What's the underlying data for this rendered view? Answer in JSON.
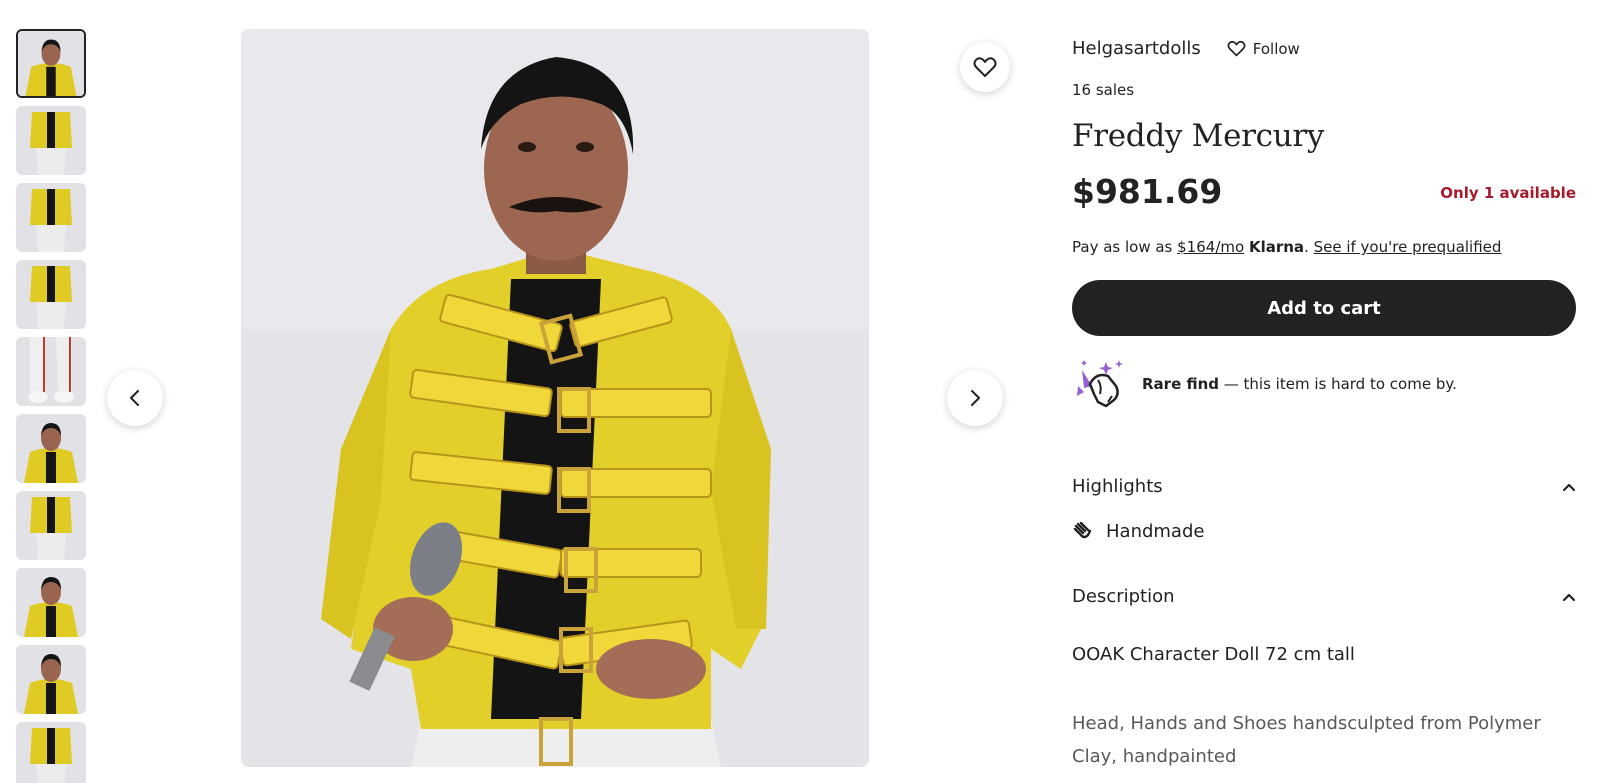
{
  "thumbnails": [
    {
      "alt": "thumbnail-1",
      "selected": true
    },
    {
      "alt": "thumbnail-2",
      "selected": false
    },
    {
      "alt": "thumbnail-3",
      "selected": false
    },
    {
      "alt": "thumbnail-4",
      "selected": false
    },
    {
      "alt": "thumbnail-5",
      "selected": false
    },
    {
      "alt": "thumbnail-6",
      "selected": false
    },
    {
      "alt": "thumbnail-7",
      "selected": false
    },
    {
      "alt": "thumbnail-8",
      "selected": false
    },
    {
      "alt": "thumbnail-9",
      "selected": false
    },
    {
      "alt": "thumbnail-10",
      "selected": false
    }
  ],
  "gallery": {
    "prev_icon": "chevron-left-icon",
    "next_icon": "chevron-right-icon",
    "favorite_icon": "heart-icon"
  },
  "shop": {
    "name": "Helgasartdolls",
    "follow_label": "Follow",
    "sales": "16 sales"
  },
  "product": {
    "title": "Freddy Mercury",
    "price": "$981.69",
    "stock": "Only 1 available"
  },
  "klarna": {
    "prefix": "Pay as low as ",
    "amount": "$164/mo",
    "brand": "Klarna",
    "separator": ". ",
    "link": "See if you're prequalified"
  },
  "cart": {
    "label": "Add to cart"
  },
  "rare": {
    "bold": "Rare find",
    "text": " — this item is hard to come by."
  },
  "highlights": {
    "title": "Highlights",
    "item": "Handmade"
  },
  "description": {
    "title": "Description",
    "line1": "OOAK Character Doll 72 cm tall",
    "line2": "Head, Hands and Shoes handsculpted from Polymer Clay, handpainted"
  },
  "colors": {
    "accent_dark": "#222222",
    "stock_red": "#a61a2e",
    "jacket_yellow": "#e8d21f"
  }
}
